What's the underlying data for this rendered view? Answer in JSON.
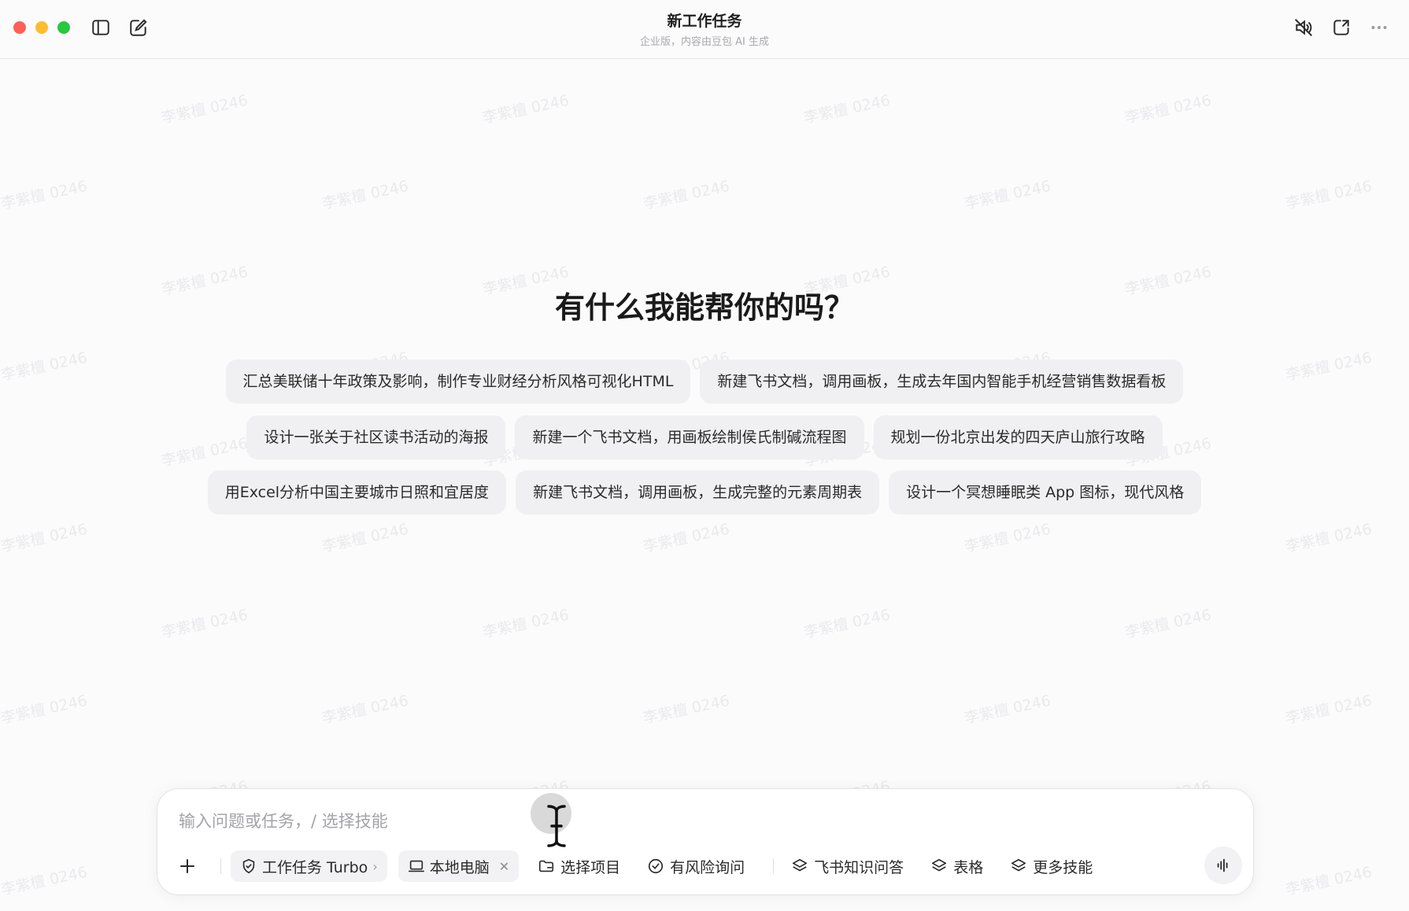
{
  "window": {
    "title": "新工作任务",
    "subtitle": "企业版，内容由豆包 AI 生成"
  },
  "watermark_text": "李紫檀 0246",
  "heading": "有什么我能帮你的吗？",
  "suggestions": [
    [
      "汇总美联储十年政策及影响，制作专业财经分析风格可视化HTML",
      "新建飞书文档，调用画板，生成去年国内智能手机经营销售数据看板"
    ],
    [
      "设计一张关于社区读书活动的海报",
      "新建一个飞书文档，用画板绘制侯氏制碱流程图",
      "规划一份北京出发的四天庐山旅行攻略"
    ],
    [
      "用Excel分析中国主要城市日照和宜居度",
      "新建飞书文档，调用画板，生成完整的元素周期表",
      "设计一个冥想睡眠类 App 图标，现代风格"
    ]
  ],
  "composer": {
    "placeholder": "输入问题或任务，/ 选择技能",
    "mode_label": "工作任务 Turbo",
    "device_label": "本地电脑",
    "select_project_label": "选择项目",
    "risk_label": "有风险询问",
    "skills": [
      "飞书知识问答",
      "表格",
      "更多技能"
    ]
  },
  "icons": {
    "sidebar_toggle": "sidebar-icon",
    "new_task": "edit-icon",
    "mute": "speaker-mute-icon",
    "new_window": "new-window-icon",
    "more": "more-icon",
    "plus": "plus-icon",
    "mode": "shield-icon",
    "device": "laptop-icon",
    "folder": "folder-icon",
    "risk": "check-circle-icon",
    "skill": "layers-icon",
    "voice": "waveform-icon"
  },
  "colors": {
    "close": "#ff5f57",
    "minimize": "#febc2e",
    "maximize": "#28c840",
    "chip_bg": "#f0f0f2"
  }
}
